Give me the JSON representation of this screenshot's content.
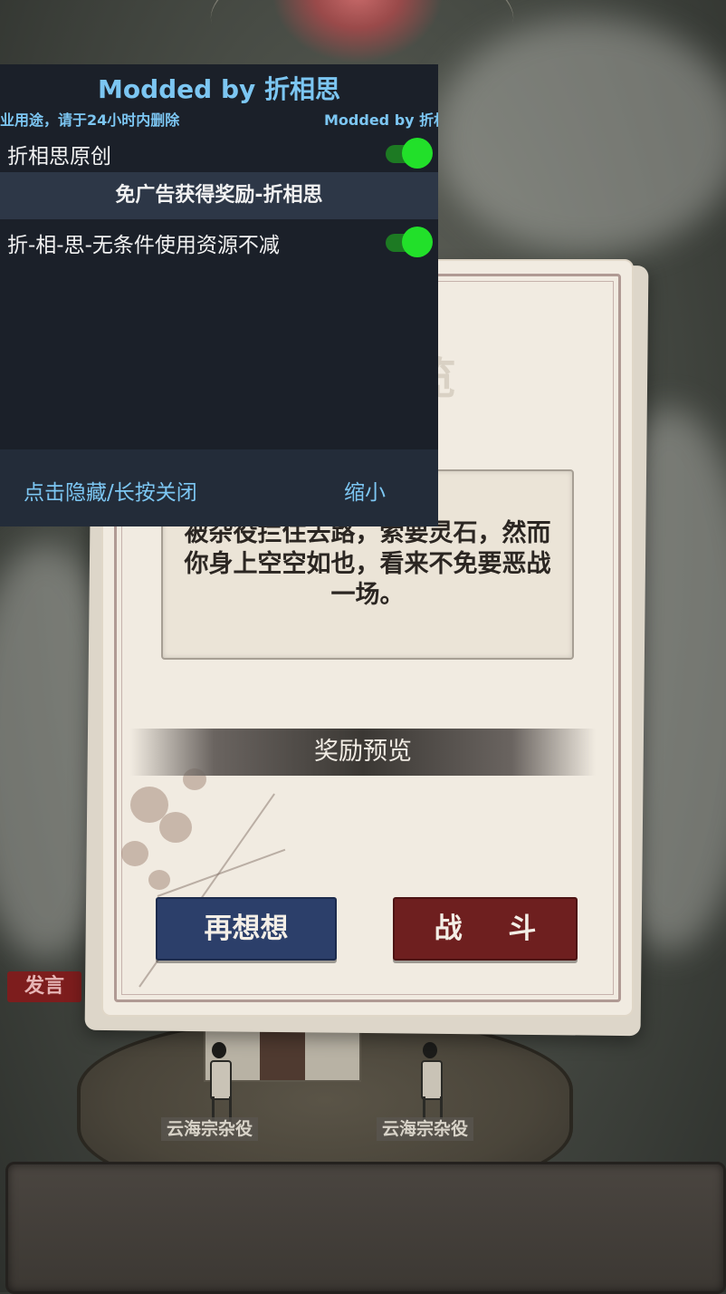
{
  "mod_menu": {
    "title": "Modded by 折相思",
    "notice_left": "业用途，请于24小时内删除",
    "notice_right": "Modded by 折相思",
    "options": [
      {
        "label": "折相思原创",
        "enabled": true
      },
      {
        "label": "折-相-思-无条件使用资源不减",
        "enabled": true
      }
    ],
    "category": "免广告获得奖励-折相思",
    "footer_hide": "点击隐藏/长按关闭",
    "footer_shrink": "缩小",
    "accent_color": "#7cc6f2",
    "toggle_on_color": "#22e02a"
  },
  "card": {
    "title": "任务预览",
    "description": "被杂役拦住去路，索要灵石，然而你身上空空如也，看来不免要恶战一场。",
    "reward_header": "奖励预览",
    "button_think": "再想想",
    "button_fight": "战 斗"
  },
  "scene": {
    "speak_button": "发言",
    "npc_left_name": "云海宗杂役",
    "npc_right_name": "云海宗杂役"
  }
}
